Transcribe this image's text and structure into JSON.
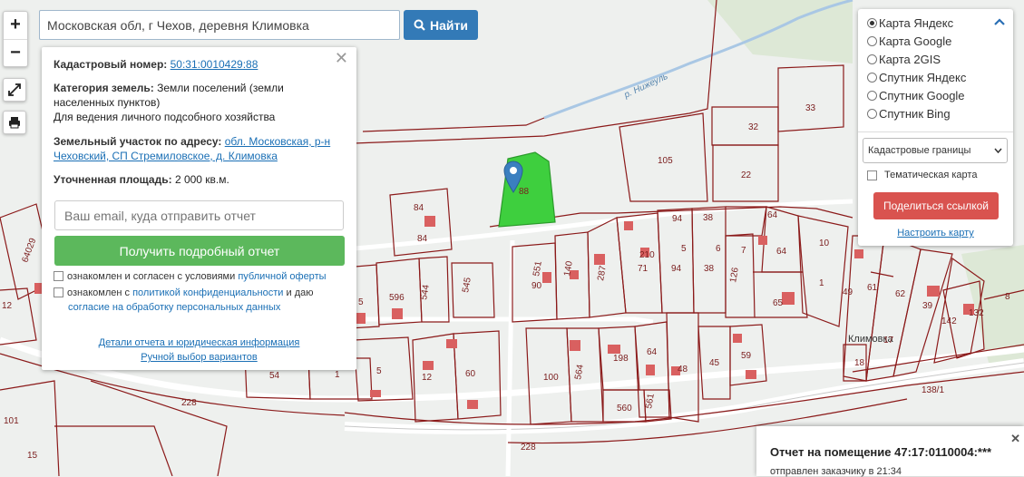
{
  "search": {
    "value": "Московская обл, г Чехов, деревня Климовка",
    "button_label": "Найти"
  },
  "zoom": {
    "in_label": "+",
    "out_label": "−"
  },
  "popup": {
    "cadastral_label": "Кадастровый номер:",
    "cadastral_value": "50:31:0010429:88",
    "category_label": "Категория земель:",
    "category_value": "Земли поселений (земли населенных пунктов)",
    "category_use": "Для ведения личного подсобного хозяйства",
    "address_label": "Земельный участок по адресу:",
    "address_value": "обл. Московская, р-н Чеховский, СП Стремиловское, д. Климовка",
    "area_label": "Уточненная площадь:",
    "area_value": "2 000 кв.м.",
    "email_placeholder": "Ваш email, куда отправить отчет",
    "report_button": "Получить подробный отчет",
    "agree1_text": "ознакомлен и согласен с условиями",
    "agree1_link": "публичной оферты",
    "agree2_text": "ознакомлен с",
    "agree2_link1": "политикой конфиденциальности",
    "agree2_mid": "и даю",
    "agree2_link2": "согласие на обработку персональных данных",
    "details_link": "Детали отчета и юридическая информация",
    "manual_link": "Ручной выбор вариантов"
  },
  "layers": {
    "options": [
      "Карта Яндекс",
      "Карта Google",
      "Карта 2GIS",
      "Спутник Яндекс",
      "Спутник Google",
      "Спутник Bing"
    ],
    "selected": "Карта Яндекс",
    "overlay_select": "Кадастровые границы",
    "thematic_label": "Тематическая карта",
    "share_button": "Поделиться ссылкой",
    "configure_link": "Настроить карту"
  },
  "notification": {
    "title": "Отчет на помещение 47:17:0110004:***",
    "subtitle": "отправлен заказчику в 21:34"
  },
  "map": {
    "street_label": "Климовка",
    "river_label": "р. Нижеуль",
    "road_label_1": "228",
    "road_label_2": "228",
    "selected_parcel_label": "88",
    "parcel_labels": [
      "84",
      "84",
      "105",
      "32",
      "33",
      "22",
      "64",
      "94",
      "38",
      "210",
      "71",
      "94",
      "5",
      "6",
      "7",
      "38",
      "126",
      "64",
      "10",
      "551",
      "140",
      "287",
      "90",
      "596",
      "544",
      "545",
      "5",
      "1",
      "65",
      "49",
      "61",
      "62",
      "39",
      "142",
      "132",
      "100",
      "564",
      "198",
      "64",
      "48",
      "45",
      "59",
      "18",
      "17",
      "560",
      "561",
      "138/1",
      "12",
      "60",
      "54",
      "1",
      "101",
      "64029",
      "12",
      "8",
      "5",
      "15"
    ]
  },
  "colors": {
    "accent": "#337ab7",
    "success": "#5cb85c",
    "danger": "#d9534f",
    "parcel_border": "#8b1a1a",
    "selected_parcel": "#33cc33"
  }
}
